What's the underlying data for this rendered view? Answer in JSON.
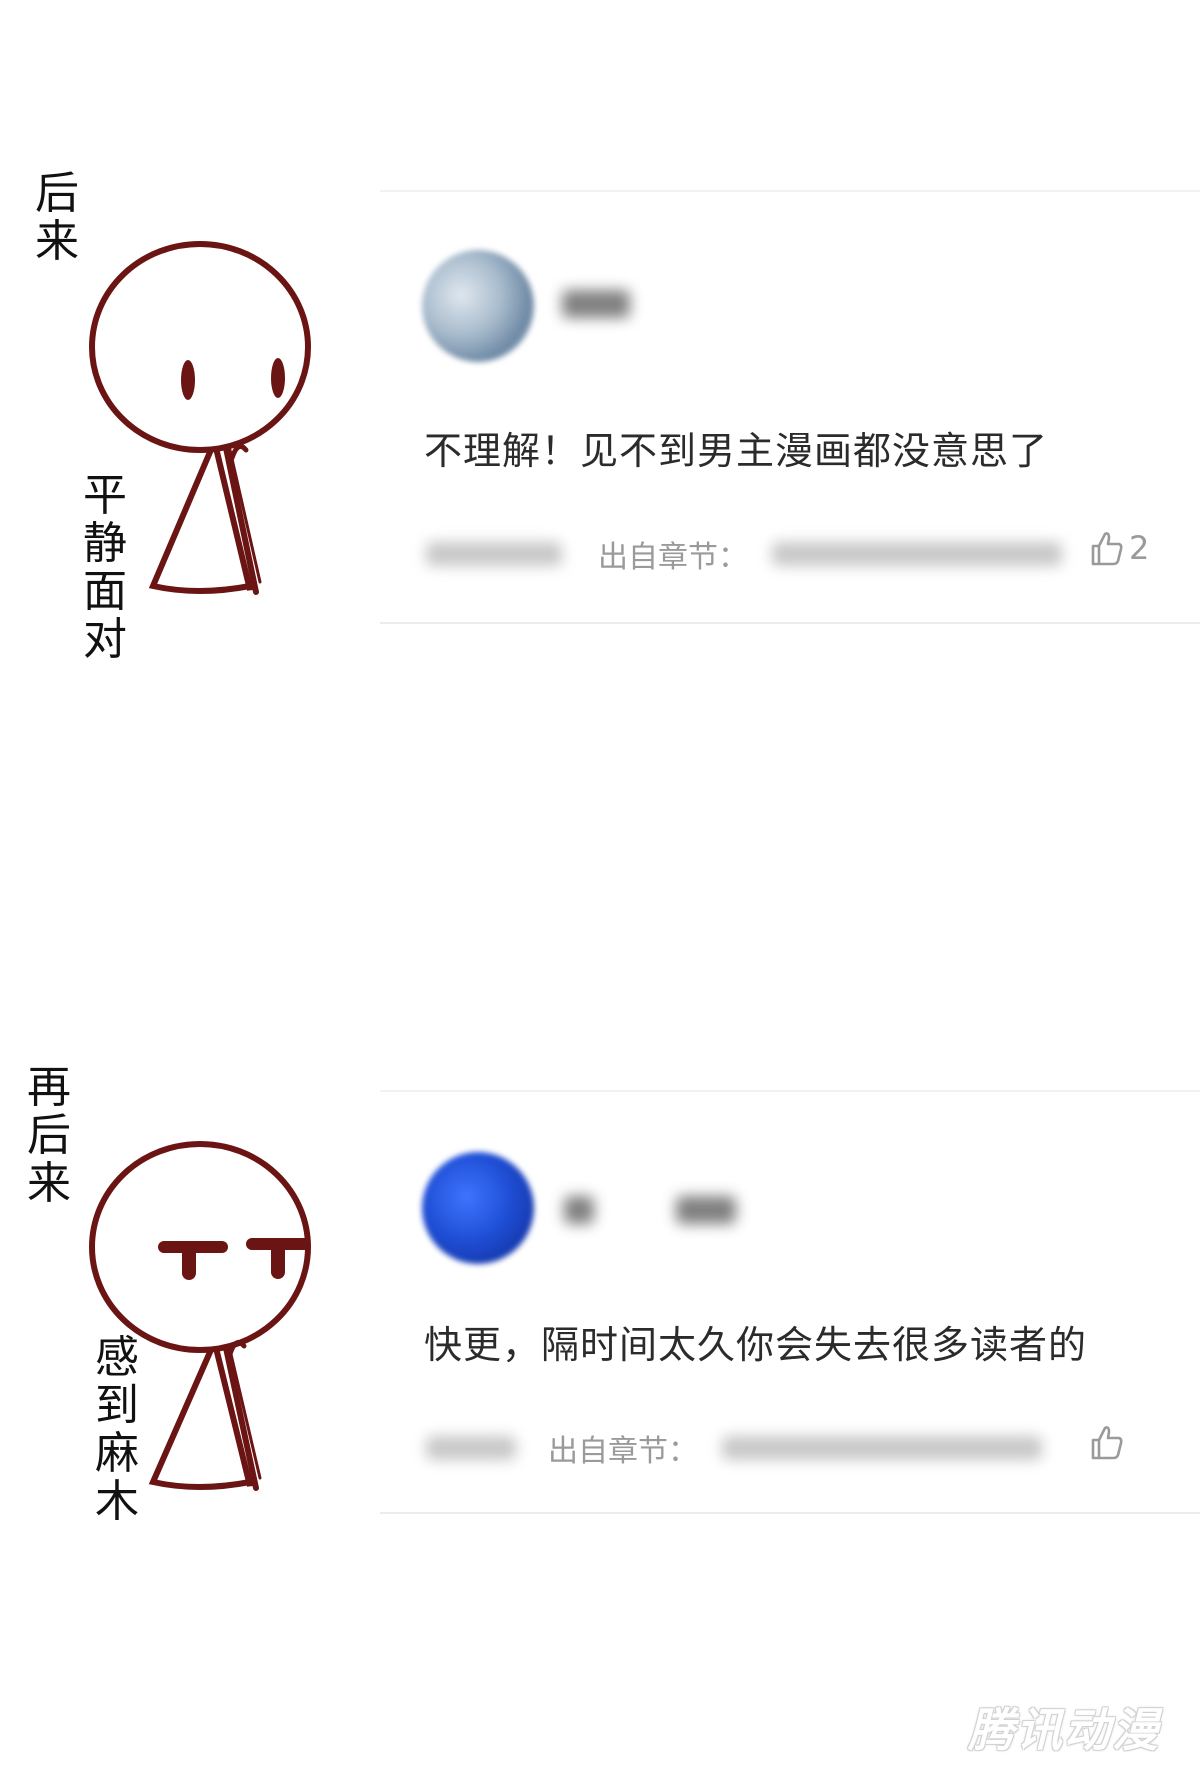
{
  "panel1": {
    "side_label": "后来",
    "figure_caption": "平静面对",
    "comment": {
      "text": "不理解！见不到男主漫画都没意思了",
      "source_label": "出自章节：",
      "like_count": "2",
      "avatar_color": "#8fa6bd"
    }
  },
  "panel2": {
    "side_label": "再后来",
    "figure_caption": "感到麻木",
    "comment": {
      "text": "快更，隔时间太久你会失去很多读者的",
      "source_label": "出自章节：",
      "like_count": "",
      "avatar_color": "#1f4fd6"
    }
  },
  "colors": {
    "stick_figure": "#6b1414",
    "comment_text": "#2b2b2b",
    "meta_text": "#9a9a9a"
  },
  "icons": {
    "like": "thumbs-up-icon"
  },
  "watermark": "腾讯动漫"
}
